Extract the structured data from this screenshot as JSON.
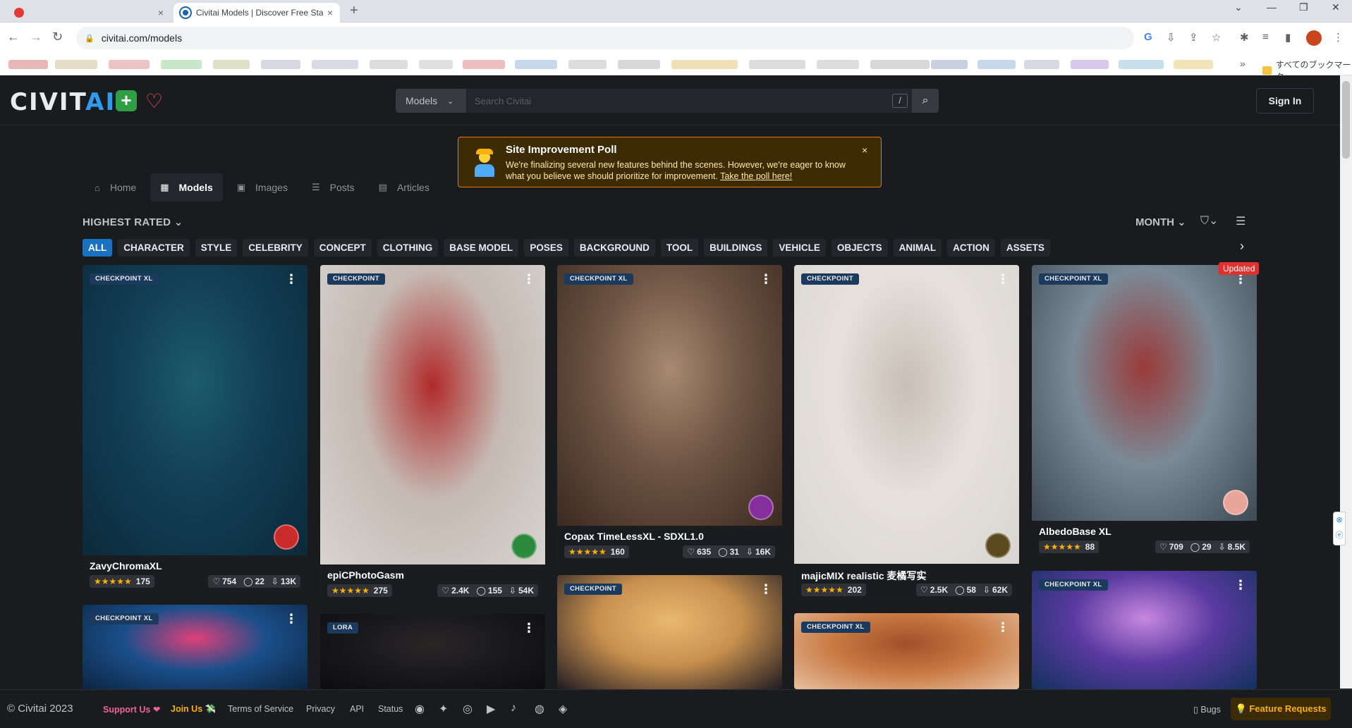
{
  "browser": {
    "tabs": [
      {
        "title": "",
        "active": false
      },
      {
        "title": "Civitai Models | Discover Free Stable Diffusion Models",
        "active": true
      }
    ],
    "url": "civitai.com/models",
    "bookmark_folder": "すべてのブックマーク"
  },
  "header": {
    "logo_main": "CIVIT",
    "logo_accent": "AI",
    "search_scope": "Models",
    "search_placeholder": "Search Civitai",
    "search_hotkey": "/",
    "sign_in_label": "Sign In"
  },
  "poll": {
    "title": "Site Improvement Poll",
    "text": "We're finalizing several new features behind the scenes. However, we're eager to know what you believe we should prioritize for improvement.",
    "link_text": "Take the poll here!",
    "close": "×"
  },
  "nav": {
    "tabs": [
      {
        "label": "Home",
        "icon": "home-icon",
        "glyph": "⌂"
      },
      {
        "label": "Models",
        "icon": "grid-icon",
        "glyph": "▦",
        "active": true
      },
      {
        "label": "Images",
        "icon": "image-icon",
        "glyph": "▣"
      },
      {
        "label": "Posts",
        "icon": "posts-icon",
        "glyph": "☰"
      },
      {
        "label": "Articles",
        "icon": "article-icon",
        "glyph": "▤"
      }
    ]
  },
  "filters": {
    "sort": "HIGHEST RATED",
    "period": "MONTH",
    "categories": [
      "ALL",
      "CHARACTER",
      "STYLE",
      "CELEBRITY",
      "CONCEPT",
      "CLOTHING",
      "BASE MODEL",
      "POSES",
      "BACKGROUND",
      "TOOL",
      "BUILDINGS",
      "VEHICLE",
      "OBJECTS",
      "ANIMAL",
      "ACTION",
      "ASSETS"
    ],
    "active_category": "ALL"
  },
  "cards": [
    {
      "type": "CHECKPOINT XL",
      "name": "ZavyChromaXL",
      "reviews": "175",
      "likes": "754",
      "comments": "22",
      "downloads": "13K",
      "colors": [
        "#0b2a3a",
        "#123e55",
        "#1c5b6e"
      ]
    },
    {
      "type": "CHECKPOINT",
      "name": "epiCPhotoGasm",
      "reviews": "275",
      "likes": "2.4K",
      "comments": "155",
      "downloads": "54K",
      "colors": [
        "#d8d4d0",
        "#c5b9b2",
        "#b02a2a"
      ]
    },
    {
      "type": "CHECKPOINT XL",
      "name": "Copax TimeLessXL - SDXL1.0",
      "reviews": "160",
      "likes": "635",
      "comments": "31",
      "downloads": "16K",
      "colors": [
        "#3a2a20",
        "#6e5443",
        "#a88a72"
      ]
    },
    {
      "type": "CHECKPOINT",
      "name": "majicMIX realistic 麦橘写实",
      "reviews": "202",
      "likes": "2.5K",
      "comments": "58",
      "downloads": "62K",
      "colors": [
        "#d9d6d2",
        "#e6e1dc",
        "#c8bfb6"
      ]
    },
    {
      "type": "CHECKPOINT XL",
      "name": "AlbedoBase XL",
      "reviews": "88",
      "likes": "709",
      "comments": "29",
      "downloads": "8.5K",
      "colors": [
        "#3d4a55",
        "#7a8a96",
        "#9a3a3a"
      ]
    },
    {
      "type": "CHECKPOINT XL",
      "colors": [
        "#0c2440",
        "#1a4f8a",
        "#e0407a"
      ]
    },
    {
      "type": "LORA",
      "colors": [
        "#0d0d0f",
        "#1a1a1e",
        "#2a2626"
      ]
    },
    {
      "type": "CHECKPOINT",
      "colors": [
        "#1e1a22",
        "#c8904e",
        "#e8b872"
      ]
    },
    {
      "type": "CHECKPOINT XL",
      "colors": [
        "#e6c0a0",
        "#c87840",
        "#a0502a"
      ]
    },
    {
      "type": "CHECKPOINT XL",
      "colors": [
        "#12315e",
        "#5a3aa0",
        "#c888e0"
      ]
    }
  ],
  "updated_badge": "Updated",
  "footer": {
    "copyright": "© Civitai 2023",
    "support": "Support Us ❤",
    "join": "Join Us 💸",
    "links": [
      "Terms of Service",
      "Privacy",
      "API",
      "Status"
    ],
    "bugs": "Bugs",
    "feature_requests": "Feature Requests"
  }
}
